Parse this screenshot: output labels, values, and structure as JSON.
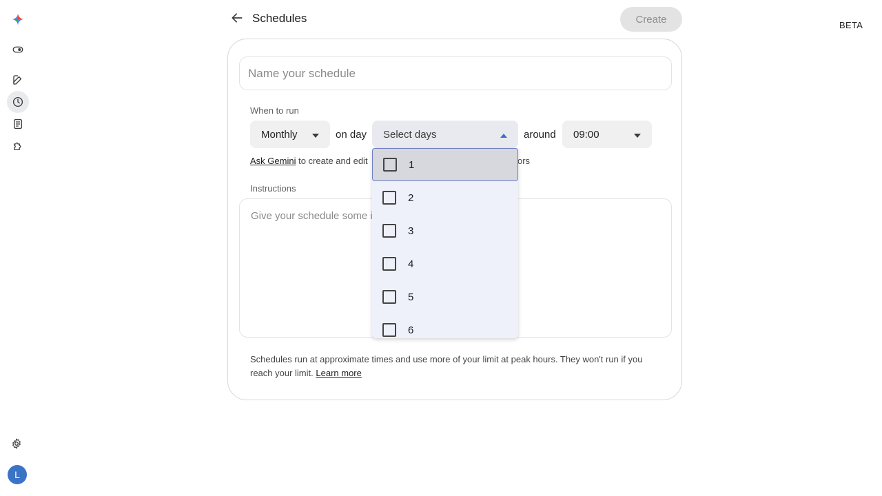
{
  "header": {
    "title": "Schedules",
    "create_label": "Create",
    "beta_label": "BETA"
  },
  "sidebar": {
    "icons": [
      "gemini-spark-icon",
      "toggle-icon",
      "new-chat-icon",
      "history-icon",
      "notes-icon",
      "extensions-icon"
    ],
    "bottom": [
      "settings-icon"
    ],
    "avatar_letter": "L"
  },
  "form": {
    "name_placeholder": "Name your schedule",
    "when_label": "When to run",
    "frequency": "Monthly",
    "on_day_label": "on day",
    "days_placeholder": "Select days",
    "around_label": "around",
    "time": "09:00",
    "hint_link": "Ask Gemini",
    "hint_text_before": "to create and edit",
    "hint_text_after": "ors",
    "instructions_label": "Instructions",
    "instructions_placeholder": "Give your schedule some i",
    "footer_text": "Schedules run at approximate times and use more of your limit at peak hours. They won't run if you reach your limit.",
    "footer_link": "Learn more"
  },
  "dropdown": {
    "options": [
      "1",
      "2",
      "3",
      "4",
      "5",
      "6"
    ],
    "focused": "1"
  },
  "colors": {
    "accent": "#3b6fd4",
    "avatar_bg": "#3b73c6",
    "dropdown_bg": "#eef0fa"
  }
}
